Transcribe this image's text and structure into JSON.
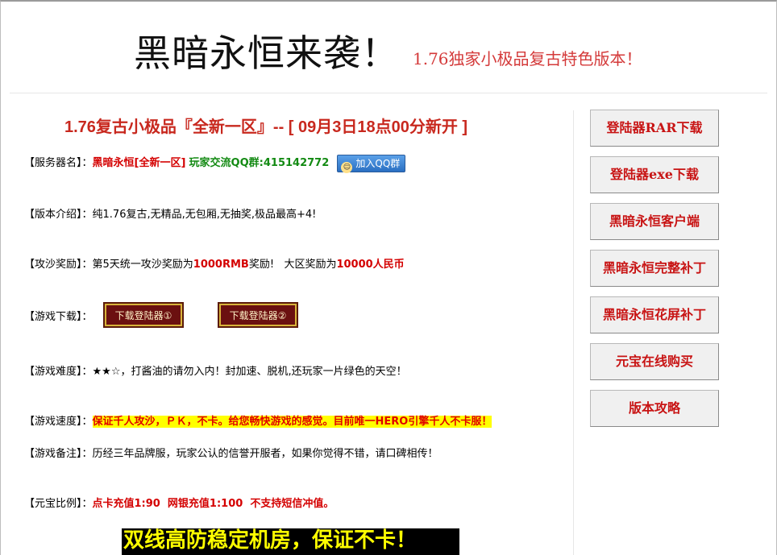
{
  "header": {
    "title": "黑暗永恒来袭！",
    "subtitle": "1.76独家小极品复古特色版本！"
  },
  "headline": "1.76复古小极品『全新一区』-- [ 09月3日18点00分新开 ]",
  "rows": {
    "server": {
      "label": "【服务器名】：",
      "name": "黑暗永恒[全新一区]",
      "qq_text": "玩家交流QQ群:415142772",
      "qq_button": "加入QQ群"
    },
    "version": {
      "label": "【版本介绍】：",
      "value": "纯1.76复古,无精品,无包厢,无抽奖,极品最高+4!"
    },
    "siege": {
      "label": "【攻沙奖励】：",
      "part1": "第5天统一攻沙奖励为",
      "amount1": "1000RMB",
      "part2": "奖励!   大区奖励为",
      "amount2": "10000人民币"
    },
    "download": {
      "label": "【游戏下载】：",
      "btn1": "下载登陆器①",
      "btn2": "下载登陆器②"
    },
    "difficulty": {
      "label": "【游戏难度】：",
      "value": "★★☆，打酱油的请勿入内！封加速、脱机,还玩家一片绿色的天空！"
    },
    "speed": {
      "label": "【游戏速度】：",
      "value": "保证千人攻沙，ＰＫ，不卡。给您畅快游戏的感觉。目前唯一HERO引擎千人不卡服！"
    },
    "notes": {
      "label": "【游戏备注】：",
      "value": "历经三年品牌服，玩家公认的信誉开服者，如果你觉得不错，请口碑相传！"
    },
    "ratio": {
      "label": "【元宝比例】：",
      "value": "点卡充值1:90  网银充值1:100  不支持短信冲值。"
    }
  },
  "banner": "双线高防稳定机房，保证不卡！",
  "sidebar": {
    "buttons": [
      "登陆器RAR下载",
      "登陆器exe下载",
      "黑暗永恒客户端",
      "黑暗永恒完整补丁",
      "黑暗永恒花屏补丁",
      "元宝在线购买",
      "版本攻略"
    ]
  }
}
